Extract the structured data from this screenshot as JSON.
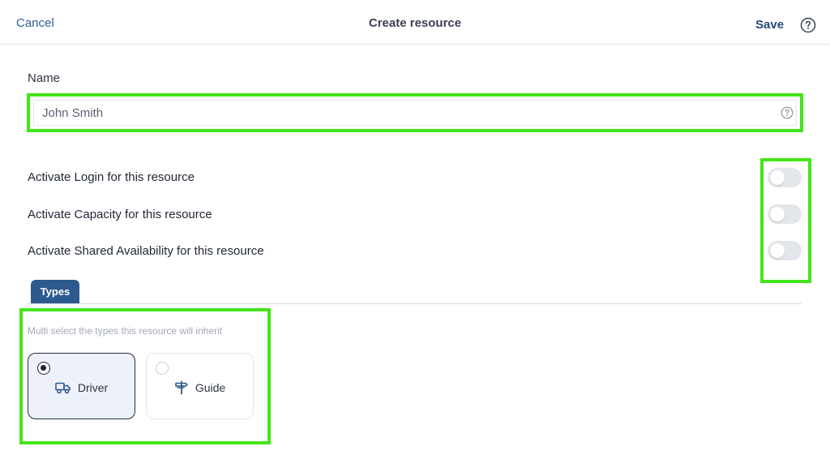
{
  "header": {
    "cancel_label": "Cancel",
    "title": "Create resource",
    "save_label": "Save"
  },
  "name_field": {
    "label": "Name",
    "value": "John Smith",
    "placeholder": ""
  },
  "toggles": [
    {
      "label": "Activate Login for this resource",
      "on": false
    },
    {
      "label": "Activate Capacity for this resource",
      "on": false
    },
    {
      "label": "Activate Shared Availability for this resource",
      "on": false
    }
  ],
  "tabs": [
    {
      "label": "Types",
      "active": true
    }
  ],
  "types": {
    "hint": "Multi select the types this resource will inherit",
    "options": [
      {
        "label": "Driver",
        "icon": "truck-icon",
        "selected": true
      },
      {
        "label": "Guide",
        "icon": "signpost-icon",
        "selected": false
      }
    ]
  },
  "colors": {
    "accent": "#2d5a8e",
    "link": "#2f5d94",
    "highlight": "#44e51a",
    "toggle_off": "#e3e6ea",
    "selected_card_bg": "#edf2fa"
  }
}
